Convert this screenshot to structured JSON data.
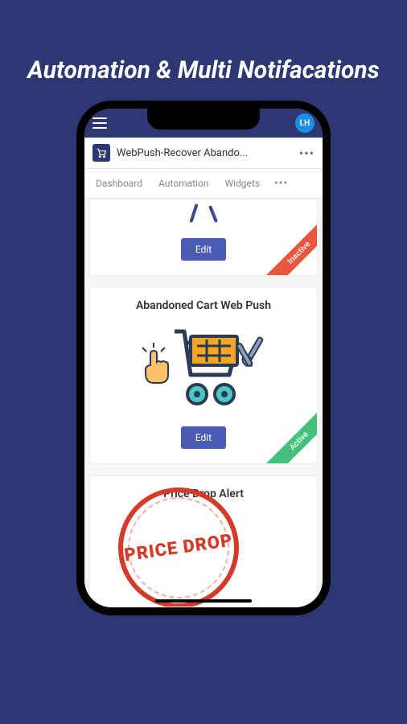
{
  "page": {
    "title": "Automation & Multi Notifacations"
  },
  "topbar": {
    "avatar_initials": "LH"
  },
  "app_header": {
    "title": "WebPush-Recover Abando..."
  },
  "tabs": {
    "items": [
      {
        "label": "Dashboard"
      },
      {
        "label": "Automation"
      },
      {
        "label": "Widgets"
      }
    ]
  },
  "cards": [
    {
      "edit_label": "Edit",
      "status": "Inactive"
    },
    {
      "title": "Abandoned Cart Web Push",
      "edit_label": "Edit",
      "status": "Active"
    },
    {
      "title": "Price Drop Alert",
      "stamp_text": "PRICE DROP"
    }
  ]
}
